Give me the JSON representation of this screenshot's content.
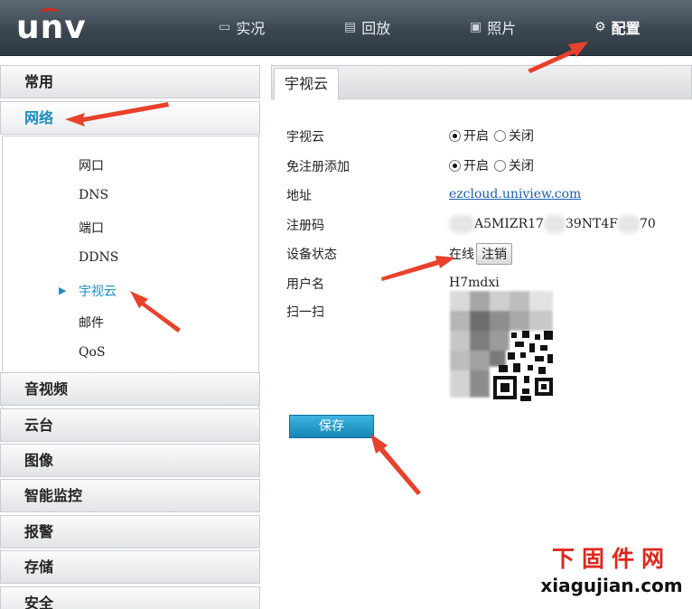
{
  "header": {
    "logo": "unv",
    "nav": [
      {
        "label": "实况",
        "icon": "monitor-icon"
      },
      {
        "label": "回放",
        "icon": "film-icon"
      },
      {
        "label": "照片",
        "icon": "image-icon"
      },
      {
        "label": "配置",
        "icon": "gear-icon",
        "active": true
      }
    ]
  },
  "sidebar": {
    "sections": [
      "常用",
      "网络",
      "音视频",
      "云台",
      "图像",
      "智能监控",
      "报警",
      "存储",
      "安全"
    ],
    "active_section": "网络",
    "network_items": [
      "网口",
      "DNS",
      "端口",
      "DDNS",
      "宇视云",
      "邮件",
      "QoS"
    ],
    "active_item": "宇视云"
  },
  "content": {
    "tab": "宇视云",
    "labels": {
      "cloud": "宇视云",
      "auto_add": "免注册添加",
      "address": "地址",
      "reg_code": "注册码",
      "device_status": "设备状态",
      "username": "用户名",
      "scan": "扫一扫"
    },
    "radio": {
      "on": "开启",
      "off": "关闭"
    },
    "address_value": "ezcloud.uniview.com",
    "reg_code_parts": [
      "A5MIZR17",
      "39NT4F",
      "70"
    ],
    "status_value": "在线",
    "logout_label": "注销",
    "username_value": "H7mdxi",
    "save_label": "保存"
  },
  "watermark": {
    "top": "下固件网",
    "bottom": "xiagujian.com"
  },
  "colors": {
    "accent": "#1b8dbf",
    "header": "#3b4650",
    "arrow": "#e8412c",
    "save": "#1f97c9"
  }
}
